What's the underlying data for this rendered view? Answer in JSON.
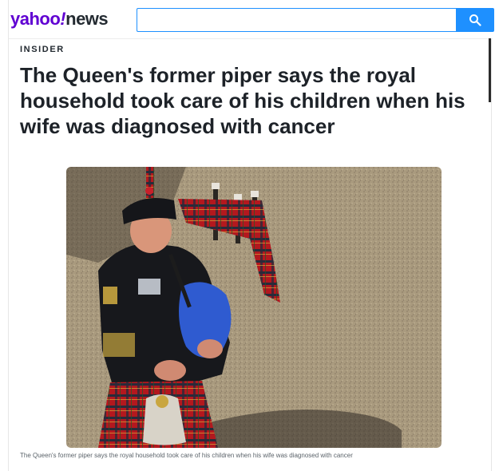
{
  "header": {
    "logo_yahoo": "yahoo",
    "logo_bang": "!",
    "logo_news": "news",
    "search": {
      "value": "",
      "placeholder": ""
    },
    "search_button_icon": "search-icon"
  },
  "article": {
    "publisher": "INSIDER",
    "title": "The Queen's former piper says the royal household took care of his children when his wife was diagnosed with cancer",
    "image_caption": "The Queen's former piper says the royal household took care of his children when his wife was diagnosed with cancer"
  },
  "colors": {
    "brand_purple": "#6001d2",
    "search_blue": "#1e90ff",
    "title_text": "#1d2228"
  }
}
